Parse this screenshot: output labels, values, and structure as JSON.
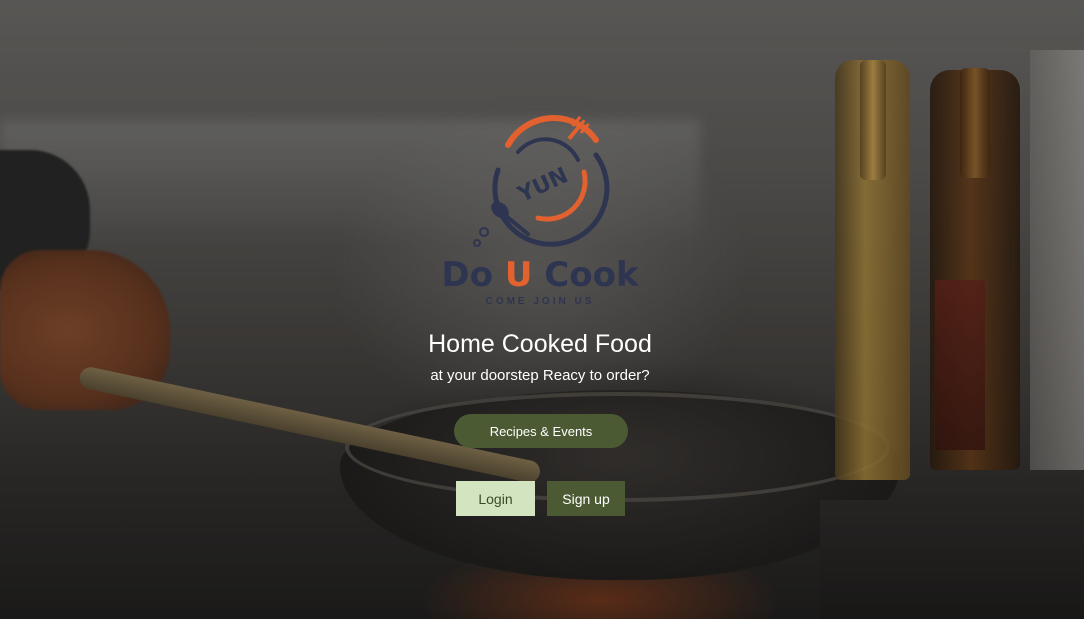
{
  "brand": {
    "name_prefix": "Do ",
    "name_accent": "U",
    "name_suffix": " Cook",
    "tagline": "COME JOIN US",
    "logo_letters": "YUN",
    "colors": {
      "navy": "#2e3550",
      "orange": "#e2612f"
    }
  },
  "hero": {
    "headline": "Home Cooked Food",
    "subline": "at your doorstep Reacy to order?"
  },
  "actions": {
    "recipes_label": "Recipes & Events",
    "login_label": "Login",
    "signup_label": "Sign up"
  },
  "colors": {
    "primary_button": "#4b5a33",
    "secondary_button": "#d3e4c0"
  }
}
